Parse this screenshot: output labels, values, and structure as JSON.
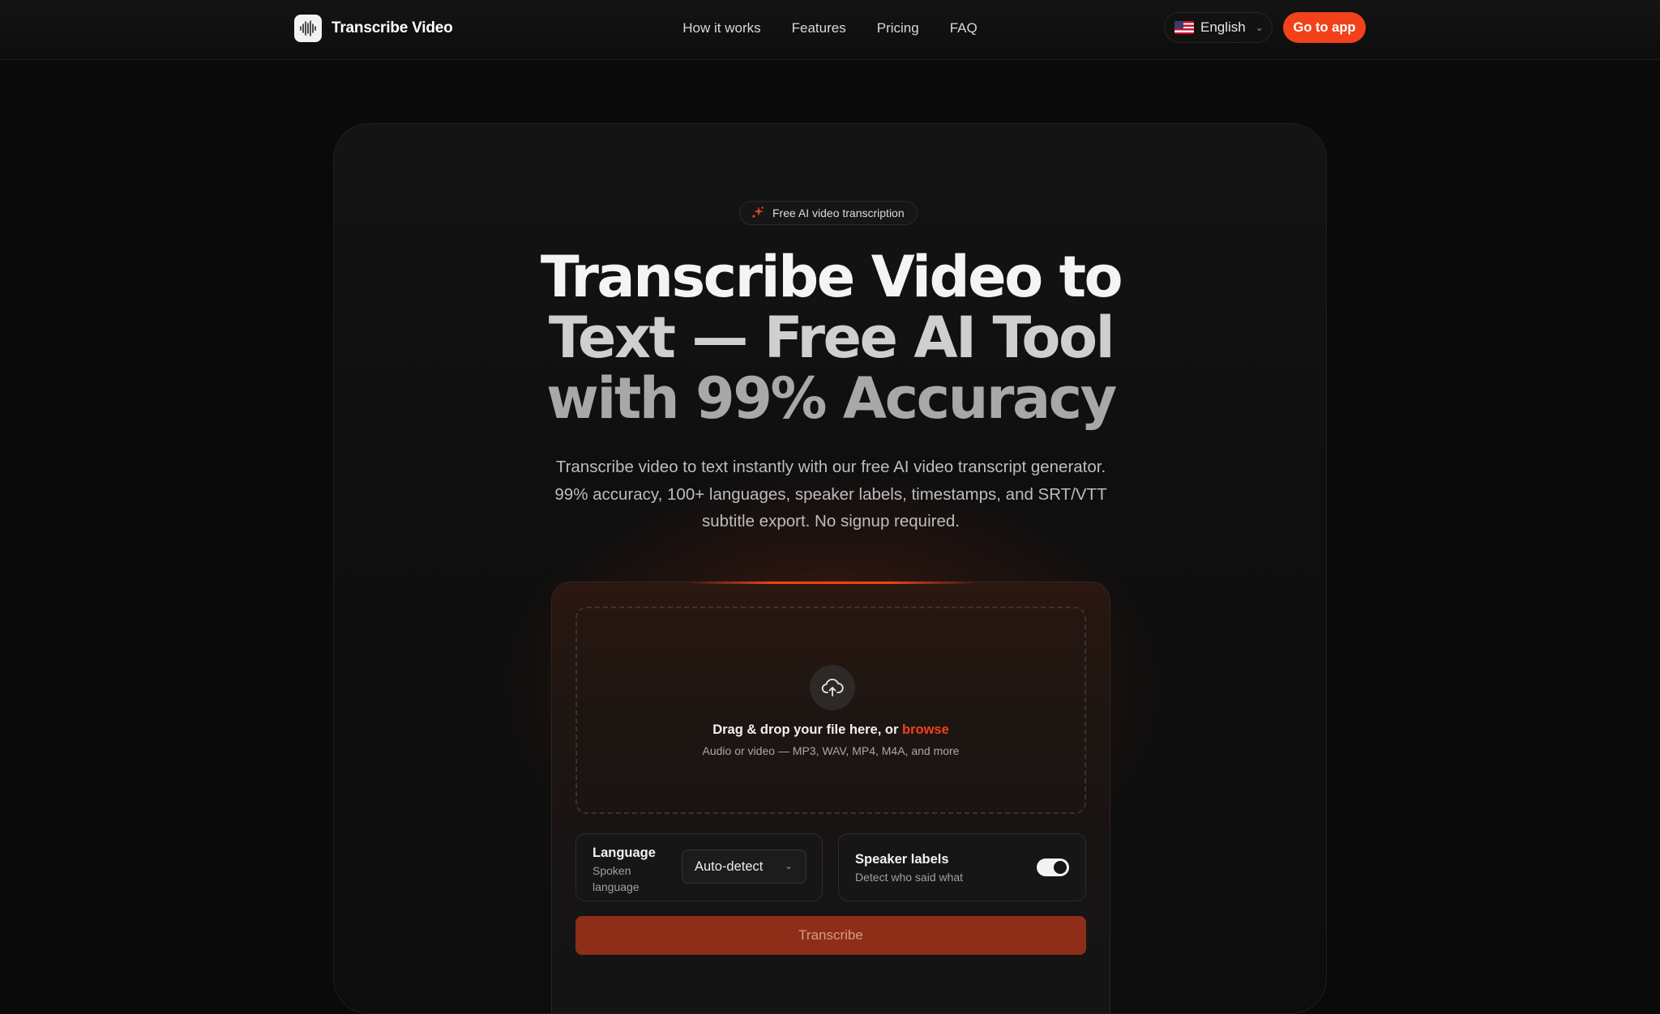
{
  "brand": {
    "name": "Transcribe Video",
    "logo_icon": "waveform-icon"
  },
  "nav": {
    "links": [
      "How it works",
      "Features",
      "Pricing",
      "FAQ"
    ],
    "language": {
      "label": "English",
      "flag_icon": "us-flag-icon"
    },
    "cta_label": "Go to app"
  },
  "hero": {
    "badge": "Free AI video transcription",
    "badge_icon": "sparkle-icon",
    "headline": {
      "line1": "Transcribe Video to",
      "line2": "Text — Free AI Tool",
      "line3": "with 99% Accuracy"
    },
    "subtitle": "Transcribe video to text instantly with our free AI video transcript generator. 99% accuracy, 100+ languages, speaker labels, timestamps, and SRT/VTT subtitle export. No signup required."
  },
  "uploader": {
    "drop_text": "Drag & drop your file here, or ",
    "browse_label": "browse",
    "formats": "Audio or video — MP3, WAV, MP4, M4A, and more",
    "language": {
      "title": "Language",
      "description": "Spoken language",
      "selected": "Auto-detect"
    },
    "speaker_labels": {
      "title": "Speaker labels",
      "description": "Detect who said what",
      "enabled": true
    },
    "submit_label": "Transcribe"
  },
  "colors": {
    "accent": "#f2411b",
    "background": "#0a0a0a",
    "submit_disabled": "#8e2e18"
  }
}
